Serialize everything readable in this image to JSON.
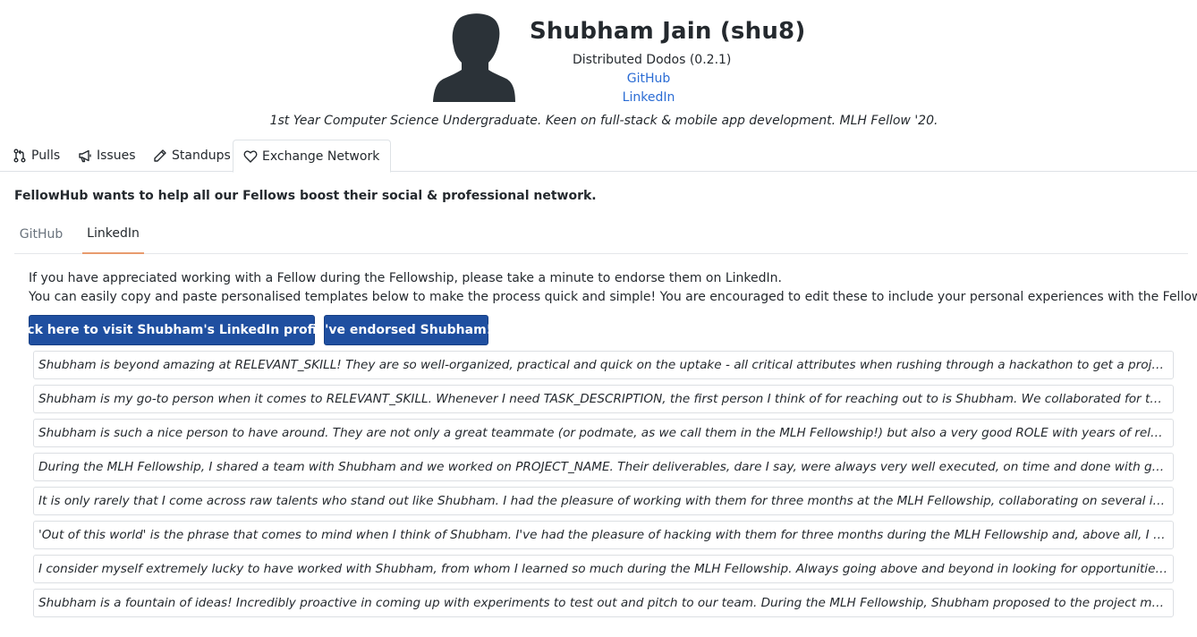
{
  "profile": {
    "name": "Shubham Jain (shu8)",
    "pod": "Distributed Dodos (0.2.1)",
    "github_label": "GitHub",
    "linkedin_label": "LinkedIn",
    "bio": "1st Year Computer Science Undergraduate. Keen on full-stack & mobile app development. MLH Fellow '20.",
    "avatar_icon": "person-silhouette-icon"
  },
  "tabs": [
    {
      "label": "Pulls",
      "icon": "pull-request-icon"
    },
    {
      "label": "Issues",
      "icon": "megaphone-icon"
    },
    {
      "label": "Standups",
      "icon": "pencil-icon"
    },
    {
      "label": "Exchange Network",
      "icon": "heart-icon",
      "active": true
    }
  ],
  "exchange": {
    "intro": "FellowHub wants to help all our Fellows boost their social & professional network.",
    "subtabs": [
      {
        "label": "GitHub"
      },
      {
        "label": "LinkedIn",
        "active": true
      }
    ],
    "info_line1": "If you have appreciated working with a Fellow during the Fellowship, please take a minute to endorse them on LinkedIn.",
    "info_line2": "You can easily copy and paste personalised templates below to make the process quick and simple! You are encouraged to edit these to include your personal experiences with the Fellow.",
    "visit_button": "Click here to visit Shubham's LinkedIn profile.",
    "endorsed_button": "I've endorsed Shubham!",
    "templates": [
      "Shubham is beyond amazing at RELEVANT_SKILL! They are so well-organized, practical and quick on the uptake - all critical attributes when rushing through a hackathon to get a project off the ground...",
      "Shubham is my go-to person when it comes to RELEVANT_SKILL. Whenever I need TASK_DESCRIPTION, the first person I think of for reaching out to is Shubham. We collaborated for three months durin...",
      "Shubham is such a nice person to have around. They are not only a great teammate (or podmate, as we call them in the MLH Fellowship!) but also a very good ROLE with years of relevant experience at...",
      "During the MLH Fellowship, I shared a team with Shubham and we worked on PROJECT_NAME. Their deliverables, dare I say, were always very well executed, on time and done with great care. They wer...",
      "It is only rarely that I come across raw talents who stand out like Shubham. I had the pleasure of working with them for three months at the MLH Fellowship, collaborating on several issues. Their abilit...",
      "'Out of this world' is the phrase that comes to mind when I think of Shubham. I've had the pleasure of hacking with them for three months during the MLH Fellowship and, above all, I was impressed wi...",
      "I consider myself extremely lucky to have worked with Shubham, from whom I learned so much during the MLH Fellowship. Always going above and beyond in looking for opportunities for our team. A...",
      "Shubham is a fountain of ideas! Incredibly proactive in coming up with experiments to test out and pitch to our team. During the MLH Fellowship, Shubham proposed to the project maintainers that ou..."
    ]
  },
  "colors": {
    "link": "#2b6cd4",
    "primary_button": "#1f4fa0",
    "active_subtab_underline": "#e89b6e",
    "avatar": "#2b3238"
  }
}
